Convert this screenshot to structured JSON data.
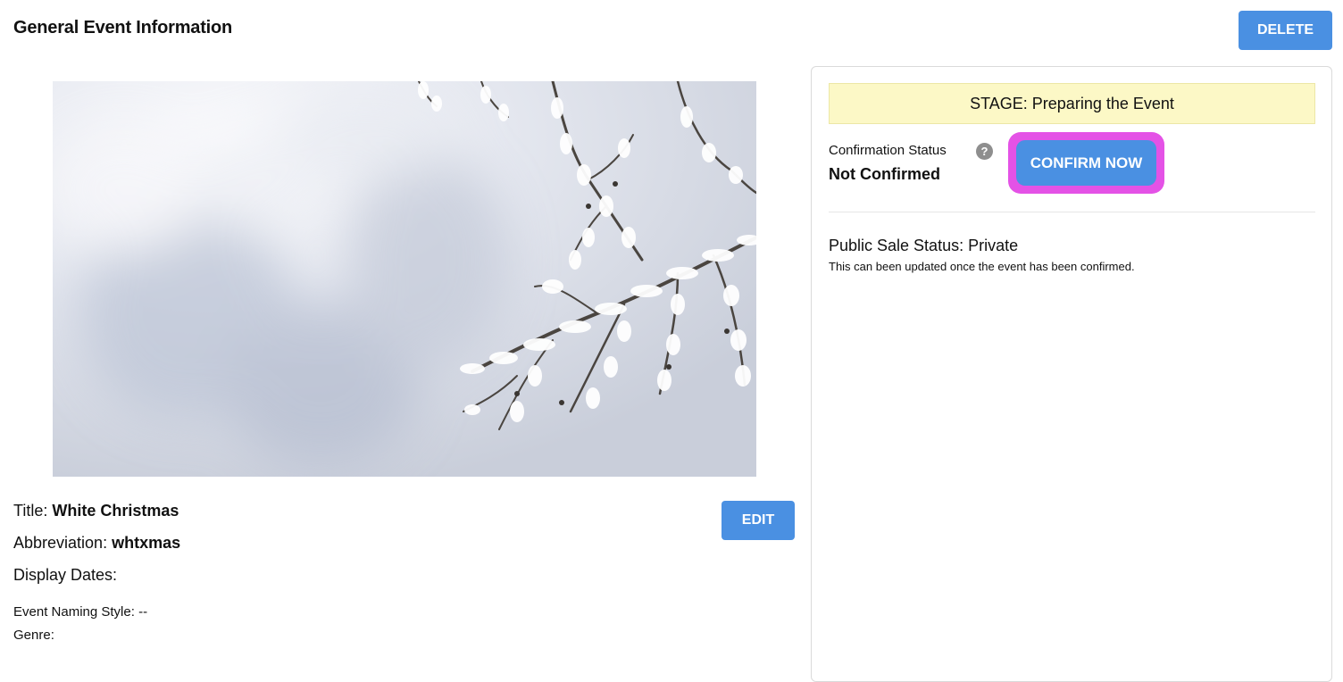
{
  "header": {
    "title": "General Event Information",
    "delete_label": "DELETE"
  },
  "event": {
    "title_label": "Title:",
    "title_value": "White Christmas",
    "abbr_label": "Abbreviation:",
    "abbr_value": "whtxmas",
    "display_dates_label": "Display Dates:",
    "naming_style_label": "Event Naming Style:",
    "naming_style_value": "--",
    "genre_label": "Genre:",
    "edit_label": "EDIT",
    "image_icon": "snowy-branch-image"
  },
  "status_panel": {
    "stage_text": "STAGE: Preparing the Event",
    "confirmation_label": "Confirmation Status",
    "help_icon": "?",
    "confirmation_value": "Not Confirmed",
    "confirm_button": "CONFIRM NOW",
    "public_sale_title": "Public Sale Status: Private",
    "public_sale_note": "This can been updated once the event has been confirmed."
  },
  "colors": {
    "accent_button": "#4a90e2",
    "highlight": "#e452e6",
    "stage_banner": "#fcf8c6"
  }
}
